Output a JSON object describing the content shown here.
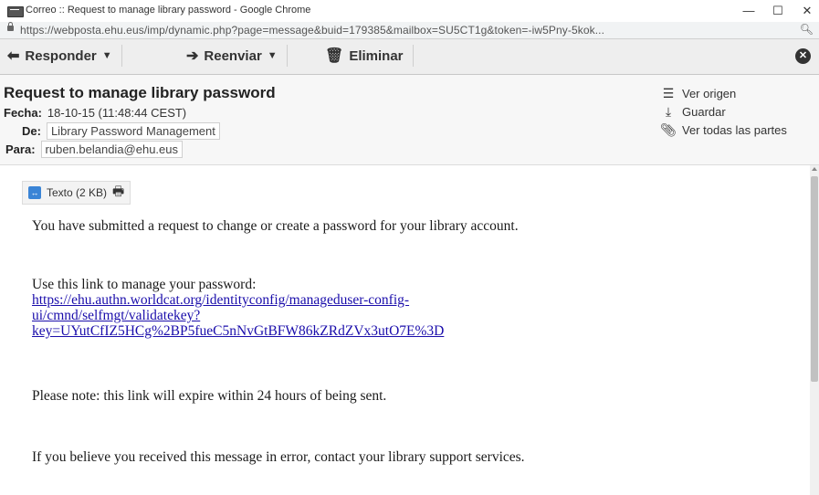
{
  "window": {
    "title": "Correo :: Request to manage library password - Google Chrome",
    "minimize": "—",
    "maximize": "☐",
    "close": "✕"
  },
  "address": {
    "url": "https://webposta.ehu.eus/imp/dynamic.php?page=message&buid=179385&mailbox=SU5CT1g&token=-iw5Pny-5kok...",
    "zoom_icon": "zoom-icon"
  },
  "toolbar": {
    "reply_label": "Responder",
    "forward_label": "Reenviar",
    "delete_label": "Eliminar"
  },
  "header": {
    "subject": "Request to manage library password",
    "fecha_label": "Fecha:",
    "fecha_value": "18-10-15 (11:48:44 CEST)",
    "de_label": "De:",
    "de_value": "Library Password Management",
    "para_label": "Para:",
    "para_value": "ruben.belandia@ehu.eus",
    "actions": {
      "view_source": "Ver origen",
      "save": "Guardar",
      "view_all_parts": "Ver todas las partes"
    }
  },
  "body": {
    "part_label": "Texto (2 KB)",
    "p1": "You have submitted a request to change or create a password for your library account.",
    "p2": "Use this link to manage your password:",
    "link_line1": "https://ehu.authn.worldcat.org/identityconfig/manageduser-config-",
    "link_line2": "ui/cmnd/selfmgt/validatekey?",
    "link_line3": "key=UYutCfIZ5HCg%2BP5fueC5nNvGtBFW86kZRdZVx3utO7E%3D",
    "p3": "Please note: this link will expire within 24 hours of being sent.",
    "p4": "If you believe you received this message in error, contact your library support services."
  }
}
